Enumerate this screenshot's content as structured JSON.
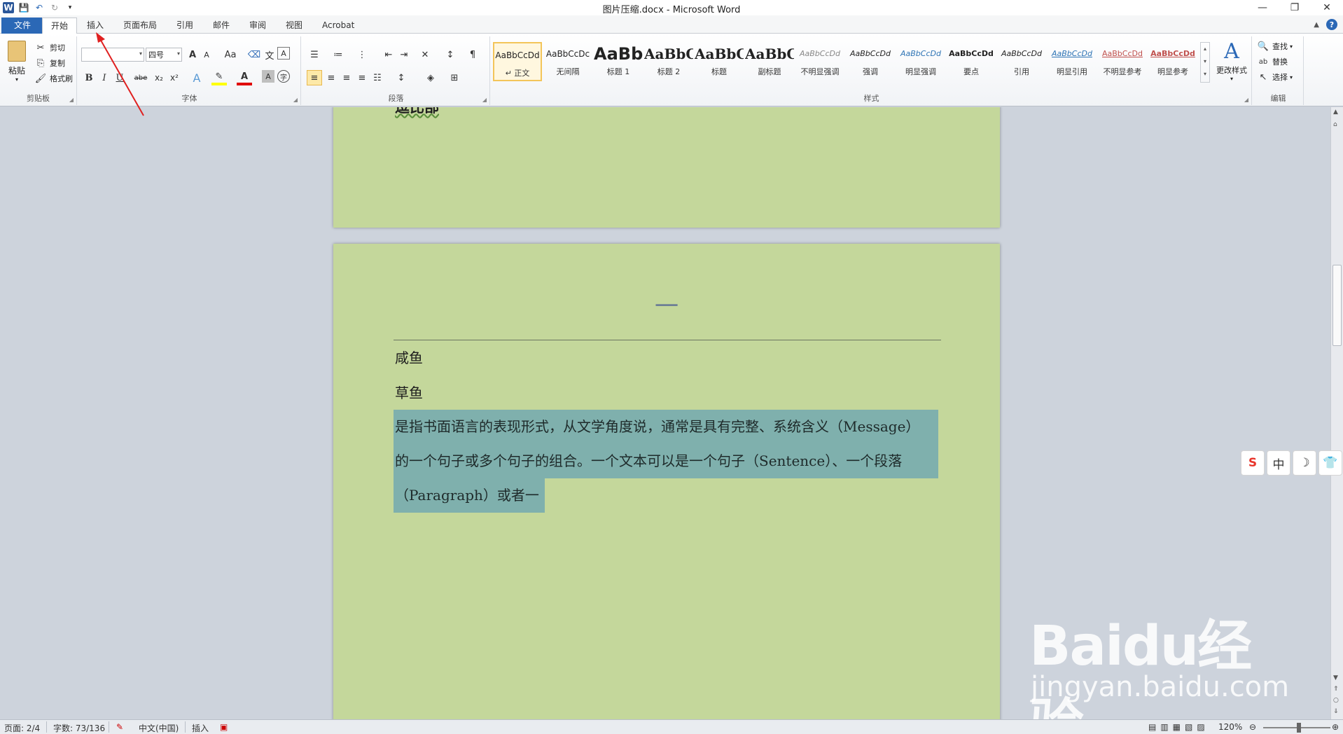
{
  "window": {
    "title": "图片压缩.docx - Microsoft Word",
    "controls": [
      "—",
      "❐",
      "✕"
    ]
  },
  "quick_access": {
    "save_icon": "save-icon",
    "undo_icon": "undo-icon",
    "redo_icon": "redo-icon"
  },
  "tabs": [
    {
      "label": "文件"
    },
    {
      "label": "开始"
    },
    {
      "label": "插入"
    },
    {
      "label": "页面布局"
    },
    {
      "label": "引用"
    },
    {
      "label": "邮件"
    },
    {
      "label": "审阅"
    },
    {
      "label": "视图"
    },
    {
      "label": "Acrobat"
    }
  ],
  "ribbon": {
    "clipboard": {
      "paste": "粘贴",
      "cut": "剪切",
      "copy": "复制",
      "format_painter": "格式刷",
      "group": "剪贴板"
    },
    "font": {
      "name": "",
      "size": "四号",
      "group": "字体",
      "case": "Aa",
      "bold": "B",
      "italic": "I",
      "underline": "U",
      "strike": "abe",
      "sub": "x₂",
      "sup": "x²",
      "grow": "A",
      "shrink": "A",
      "text_effect": "A",
      "font_color": "A",
      "shading": "A",
      "enclose": "字",
      "pinyin": "文"
    },
    "paragraph": {
      "group": "段落"
    },
    "styles": {
      "group": "样式",
      "items": [
        {
          "preview": "AaBbCcDd",
          "name": "↵ 正文"
        },
        {
          "preview": "AaBbCcDc",
          "name": "无间隔"
        },
        {
          "preview": "AaBb",
          "name": "标题 1"
        },
        {
          "preview": "AaBbC",
          "name": "标题 2"
        },
        {
          "preview": "AaBbC",
          "name": "标题"
        },
        {
          "preview": "AaBbC",
          "name": "副标题"
        },
        {
          "preview": "AaBbCcDd",
          "name": "不明显强调"
        },
        {
          "preview": "AaBbCcDd",
          "name": "强调"
        },
        {
          "preview": "AaBbCcDd",
          "name": "明显强调"
        },
        {
          "preview": "AaBbCcDd",
          "name": "要点"
        },
        {
          "preview": "AaBbCcDd",
          "name": "引用"
        },
        {
          "preview": "AaBbCcDd",
          "name": "明显引用"
        },
        {
          "preview": "AaBbCcDd",
          "name": "不明显参考"
        },
        {
          "preview": "AaBbCcDd",
          "name": "明显参考"
        }
      ],
      "change_styles": "更改样式"
    },
    "editing": {
      "find": "查找",
      "replace": "替换",
      "select": "选择",
      "group": "编辑"
    }
  },
  "document": {
    "page1_text": "逗比部",
    "page2_heading": "一",
    "line1": "咸鱼",
    "line2": "草鱼",
    "selected_lines": [
      "是指书面语言的表现形式，从文学角度说，通常是具有完整、系统含义（Message）",
      "的一个句子或多个句子的组合。一个文本可以是一个句子（Sentence）、一个段落",
      "（Paragraph）或者一"
    ]
  },
  "ime_toolbar": [
    "S",
    "中",
    "☽",
    "👕"
  ],
  "statusbar": {
    "page": "页面: 2/4",
    "words": "字数: 73/136",
    "language": "中文(中国)",
    "mode": "插入",
    "zoom": "120%"
  },
  "watermark": {
    "brand": "Baidu经验",
    "url": "jingyan.baidu.com"
  }
}
